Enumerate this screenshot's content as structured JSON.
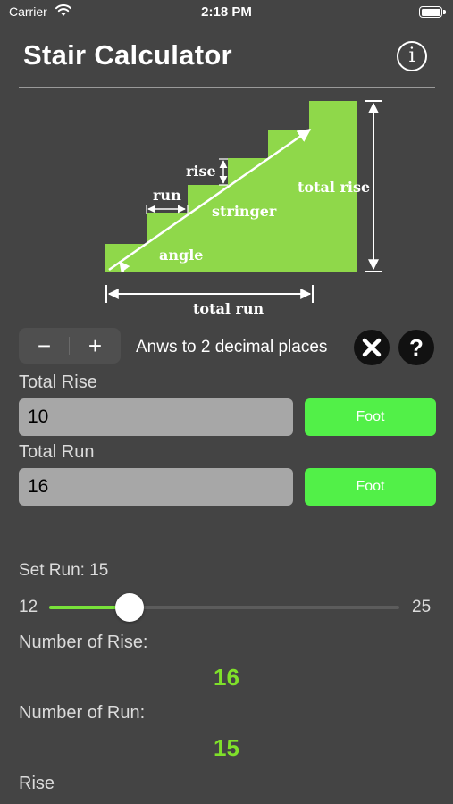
{
  "status_bar": {
    "carrier": "Carrier",
    "time": "2:18 PM"
  },
  "header": {
    "title": "Stair Calculator",
    "info_icon_glyph": "i"
  },
  "diagram": {
    "labels": {
      "rise": "rise",
      "run": "run",
      "stringer": "stringer",
      "total_rise": "total rise",
      "angle": "angle",
      "total_run": "total run"
    },
    "colors": {
      "stairs": "#8fd84a",
      "annotation": "#ffffff"
    }
  },
  "controls": {
    "minus_glyph": "−",
    "plus_glyph": "+",
    "decimals_label": "Anws to 2 decimal places",
    "help_glyph": "?"
  },
  "inputs": {
    "total_rise": {
      "label": "Total Rise",
      "value": "10",
      "unit": "Foot"
    },
    "total_run": {
      "label": "Total Run",
      "value": "16",
      "unit": "Foot"
    }
  },
  "run_slider": {
    "label": "Set Run: 15",
    "min_label": "12",
    "max_label": "25",
    "min": 12,
    "max": 25,
    "value": 15
  },
  "results": {
    "number_of_rise": {
      "label": "Number of Rise:",
      "value": "16"
    },
    "number_of_run": {
      "label": "Number of Run:",
      "value": "15"
    },
    "rise": {
      "label": "Rise"
    }
  },
  "colors": {
    "background": "#444444",
    "accent_green": "#52f048",
    "result_green": "#7fe02a",
    "slider_fill": "#79e23a"
  }
}
